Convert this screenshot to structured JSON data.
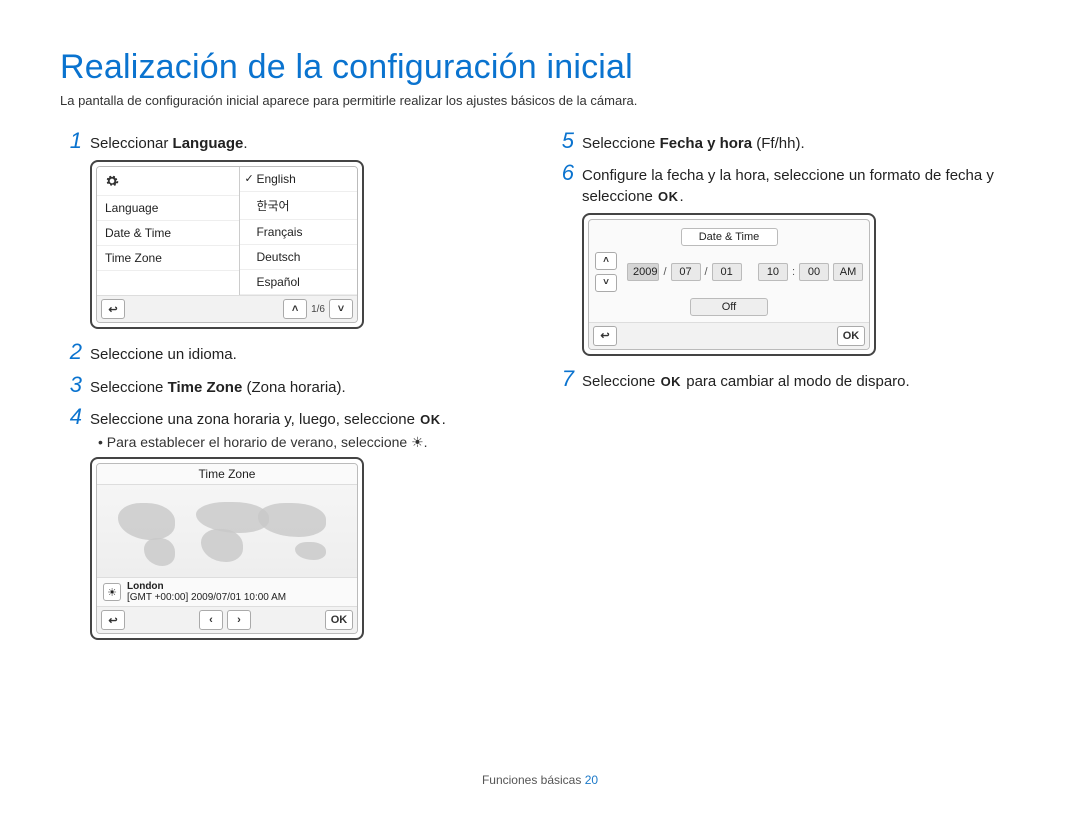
{
  "title": "Realización de la configuración inicial",
  "subtitle": "La pantalla de configuración inicial aparece para permitirle realizar los ajustes básicos de la cámara.",
  "steps": {
    "s1_pre": "Seleccionar ",
    "s1_bold": "Language",
    "s1_post": ".",
    "s2": "Seleccione un idioma.",
    "s3_pre": "Seleccione ",
    "s3_bold": "Time Zone",
    "s3_post": " (Zona horaria).",
    "s4_pre": "Seleccione una zona horaria y, luego, seleccione ",
    "s4_bullet_pre": "Para establecer el horario de verano, seleccione ",
    "s5_pre": "Seleccione ",
    "s5_bold": "Fecha y hora",
    "s5_post": " (Ff/hh).",
    "s6_pre": "Configure la fecha y la hora, seleccione un formato de fecha y seleccione ",
    "s7_pre": "Seleccione ",
    "s7_post": " para cambiar al modo de disparo."
  },
  "nums": {
    "n1": "1",
    "n2": "2",
    "n3": "3",
    "n4": "4",
    "n5": "5",
    "n6": "6",
    "n7": "7"
  },
  "ok_glyph": "OK",
  "sun_glyph": "☀",
  "back_glyph": "↩",
  "up_glyph": "˄",
  "down_glyph": "˅",
  "left_glyph": "‹",
  "right_glyph": "›",
  "lang_screen": {
    "left_items": [
      "Language",
      "Date & Time",
      "Time Zone"
    ],
    "right_items": [
      "English",
      "한국어",
      "Français",
      "Deutsch",
      "Español"
    ],
    "page_indicator": "1/6"
  },
  "tz_screen": {
    "title": "Time Zone",
    "city": "London",
    "offset_line": "[GMT +00:00] 2009/07/01 10:00 AM"
  },
  "dt_screen": {
    "title": "Date & Time",
    "year": "2009",
    "month": "07",
    "day": "01",
    "hour": "10",
    "minute": "00",
    "ampm": "AM",
    "sep_date": "/",
    "sep_time": ":",
    "off": "Off"
  },
  "footer": {
    "section": "Funciones básicas",
    "page": "20"
  }
}
